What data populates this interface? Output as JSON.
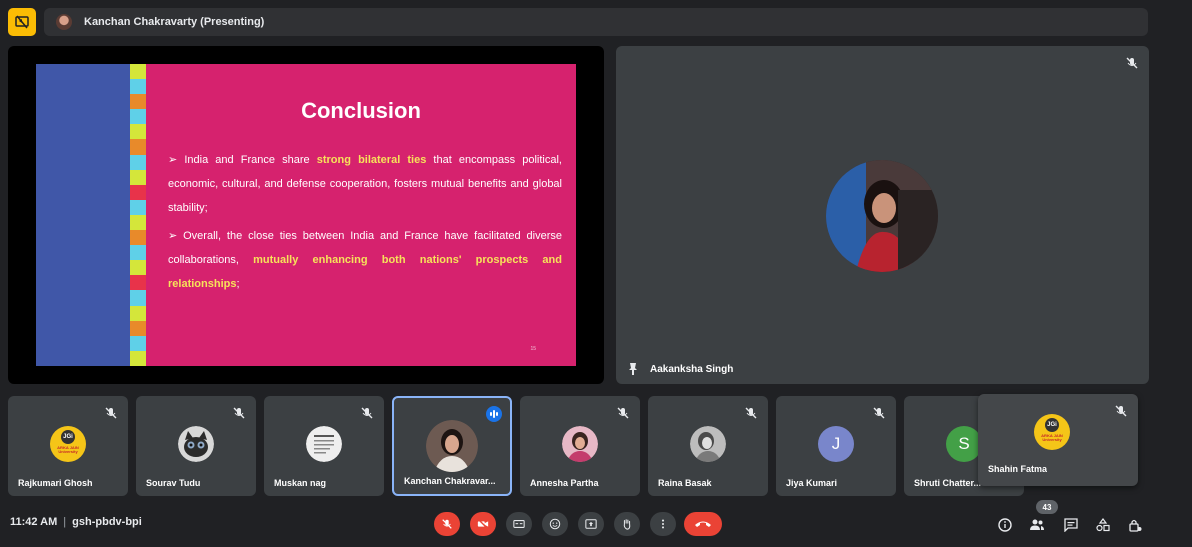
{
  "presenter_bar": {
    "label": "Kanchan Chakravarty (Presenting)"
  },
  "slide": {
    "title": "Conclusion",
    "bullet1": {
      "prefix": "India and France share ",
      "highlight": "strong bilateral ties",
      "suffix": " that encompass political, economic, cultural, and defense cooperation, fosters mutual benefits and global stability;"
    },
    "bullet2": {
      "prefix": "Overall, the close ties between India and France have facilitated diverse collaborations, ",
      "highlight": "mutually enhancing both nations' prospects and relationships",
      "suffix": ";"
    },
    "page_number": "15",
    "stripe_colors": [
      "#d4e63a",
      "#5fd0e8",
      "#e88a2a",
      "#5fd0e8",
      "#d4e63a",
      "#e88a2a",
      "#5fd0e8",
      "#d4e63a",
      "#e8334a",
      "#5fd0e8",
      "#d4e63a",
      "#e88a2a",
      "#5fd0e8",
      "#d4e63a",
      "#e8334a",
      "#5fd0e8",
      "#d4e63a",
      "#e88a2a",
      "#5fd0e8",
      "#d4e63a"
    ]
  },
  "spotlight": {
    "name": "Aakanksha Singh"
  },
  "participants": [
    {
      "name": "Rajkumari Ghosh",
      "avatar": "jgi-logo"
    },
    {
      "name": "Sourav Tudu",
      "avatar": "cat-photo"
    },
    {
      "name": "Muskan nag",
      "avatar": "document-photo"
    },
    {
      "name": "Kanchan Chakravar...",
      "avatar": "profile-photo"
    },
    {
      "name": "Annesha Partha",
      "avatar": "profile-photo"
    },
    {
      "name": "Raina Basak",
      "avatar": "profile-photo"
    },
    {
      "name": "Jiya Kumari",
      "avatar": "letter",
      "letter": "J",
      "color": "#7986cb"
    },
    {
      "name": "Shruti Chatter...",
      "avatar": "letter",
      "letter": "S",
      "color": "#43a047"
    },
    {
      "name": "Shahin Fatma",
      "avatar": "jgi-logo"
    }
  ],
  "jgi_logo": {
    "mark": "JGi",
    "line1": "ARKA JAIN",
    "line2": "University"
  },
  "meeting": {
    "time": "11:42 AM",
    "separator": "|",
    "code": "gsh-pbdv-bpi"
  },
  "people_count": "43",
  "colors": {
    "accent": "#8ab4f8",
    "danger": "#ea4335",
    "present": "#fbbc04",
    "slide_bg": "#d6226e",
    "highlight": "#f7e25a"
  }
}
